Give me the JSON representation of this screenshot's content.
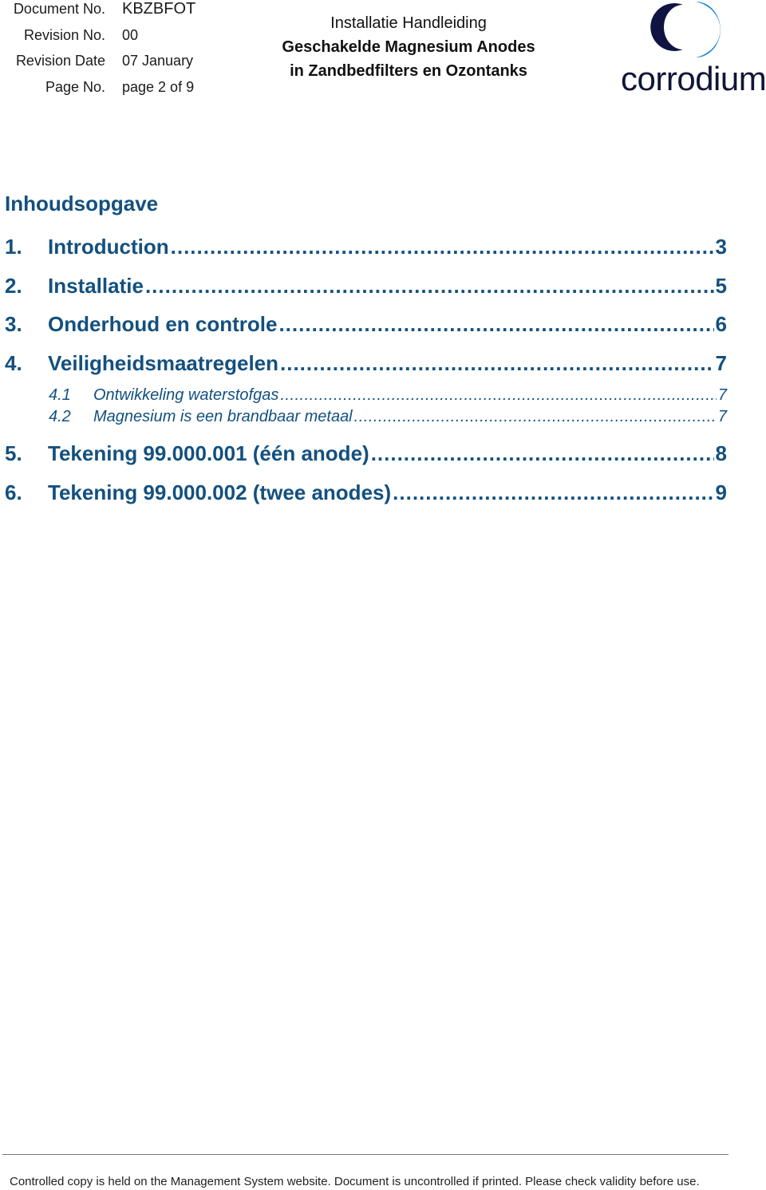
{
  "header": {
    "meta": [
      {
        "label": "Document No.",
        "value": "KBZBFOT"
      },
      {
        "label": "Revision No.",
        "value": "00"
      },
      {
        "label": "Revision Date",
        "value": "07 January"
      },
      {
        "label": "Page No.",
        "value": "page 2 of 9"
      }
    ],
    "title_lines": [
      "Installatie Handleiding",
      "Geschakelde Magnesium Anodes",
      "in Zandbedfilters en Ozontanks"
    ],
    "logo": {
      "icon": "crescent-moon-logo-icon",
      "wordmark": "corrodium",
      "colors": {
        "dark": "#0f1540",
        "light": "#1f86d6"
      }
    }
  },
  "toc": {
    "title": "Inhoudsopgave",
    "accent_color": "#13507f",
    "entries": [
      {
        "level": 1,
        "number": "1.",
        "text": "Introduction",
        "page": "3"
      },
      {
        "level": 1,
        "number": "2.",
        "text": "Installatie",
        "page": "5"
      },
      {
        "level": 1,
        "number": "3.",
        "text": "Onderhoud en controle",
        "page": "6"
      },
      {
        "level": 1,
        "number": "4.",
        "text": "Veiligheidsmaatregelen",
        "page": "7"
      },
      {
        "level": 2,
        "number": "4.1",
        "text": "Ontwikkeling waterstofgas",
        "page": "7"
      },
      {
        "level": 2,
        "number": "4.2",
        "text": "Magnesium is een brandbaar metaal",
        "page": "7"
      },
      {
        "level": 1,
        "number": "5.",
        "text": "Tekening 99.000.001 (één anode)",
        "page": "8"
      },
      {
        "level": 1,
        "number": "6.",
        "text": "Tekening 99.000.002 (twee anodes)",
        "page": "9"
      }
    ]
  },
  "footer": {
    "text": "Controlled copy is held on the Management System website. Document is uncontrolled if printed. Please check validity before use."
  }
}
